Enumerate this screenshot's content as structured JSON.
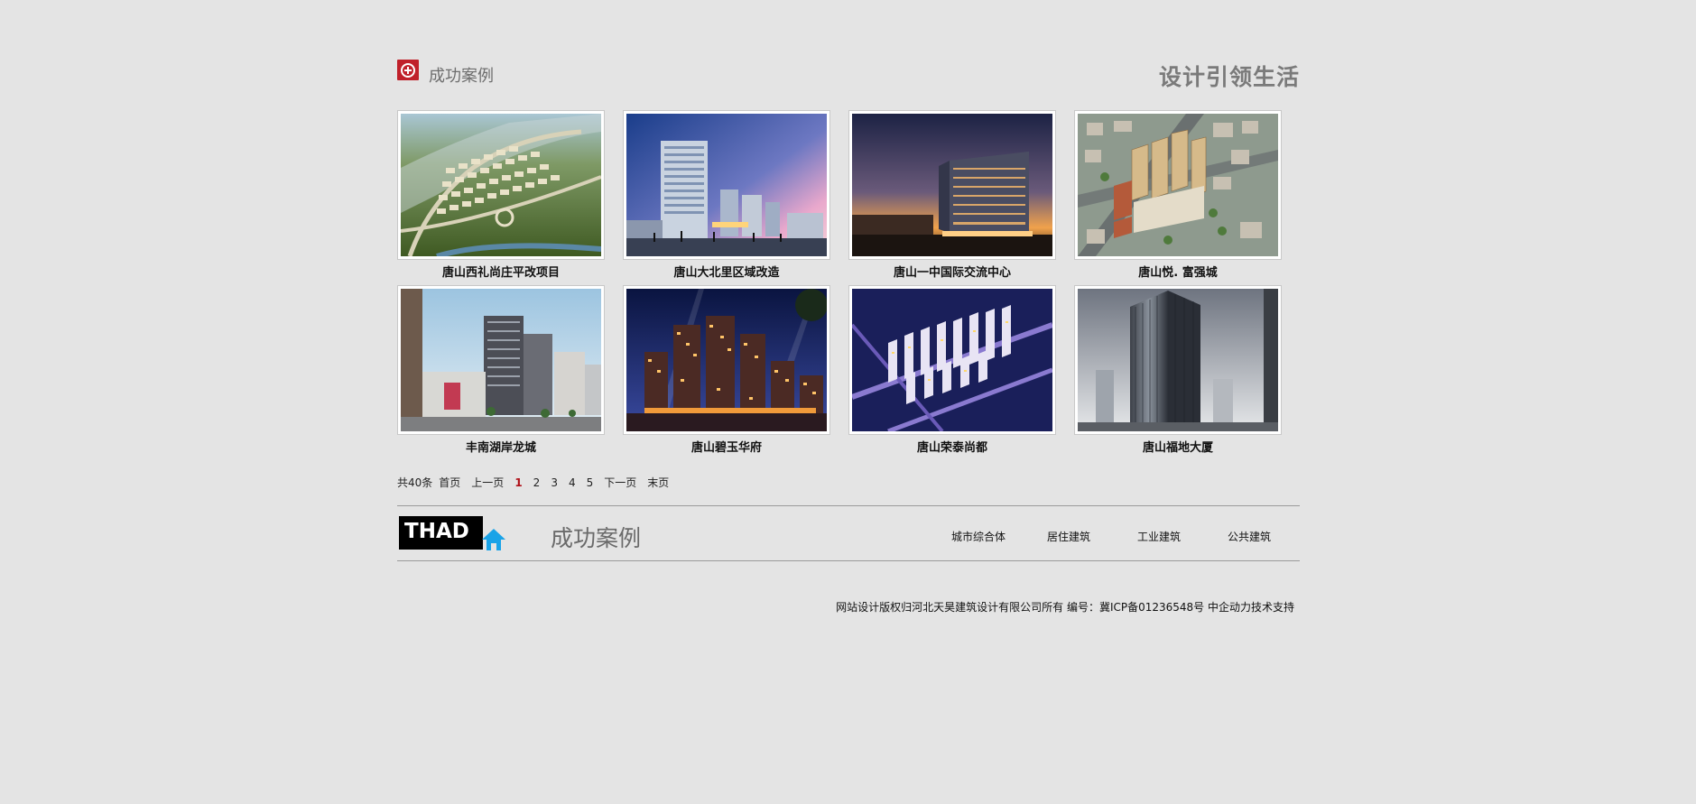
{
  "header": {
    "title": "成功案例",
    "slogan": "设计引领生活"
  },
  "projects": [
    {
      "name": "唐山西礼尚庄平改项目"
    },
    {
      "name": "唐山大北里区域改造"
    },
    {
      "name": "唐山一中国际交流中心"
    },
    {
      "name": "唐山悦. 富强城"
    },
    {
      "name": "丰南湖岸龙城"
    },
    {
      "name": "唐山碧玉华府"
    },
    {
      "name": "唐山荣泰尚都"
    },
    {
      "name": "唐山福地大厦"
    }
  ],
  "pagination": {
    "total": "共40条",
    "first": "首页",
    "prev": "上一页",
    "pages": [
      "1",
      "2",
      "3",
      "4",
      "5"
    ],
    "current": "1",
    "next": "下一页",
    "last": "末页"
  },
  "footer_nav": {
    "brand": "THAD",
    "section_title": "成功案例",
    "links": [
      "城市综合体",
      "居住建筑",
      "工业建筑",
      "公共建筑"
    ]
  },
  "copyright": "网站设计版权归河北天昊建筑设计有限公司所有 编号：冀ICP备01236548号 中企动力技术支持",
  "colors": {
    "background": "#e4e4e4",
    "accent_red": "#c0202a",
    "brand_blue": "#1aa3e8"
  }
}
